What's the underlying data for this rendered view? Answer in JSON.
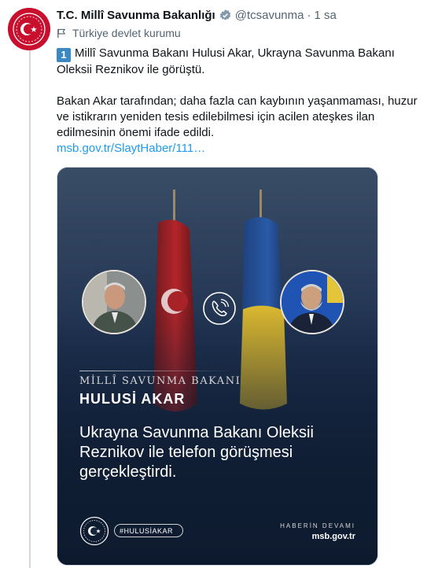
{
  "tweet": {
    "author_name": "T.C. Millî Savunma Bakanlığı",
    "verified_icon": "verified-badge-icon",
    "handle": "@tcsavunma",
    "separator": "·",
    "time": "1 sa",
    "affiliation_label": "Türkiye devlet kurumu",
    "number_emoji": "1",
    "text_line1": "Millî Savunma Bakanı Hulusi Akar, Ukrayna Savunma Bakanı Oleksii Reznikov ile görüştü.",
    "text_para2": "Bakan Akar tarafından; daha fazla can kaybının yaşanmaması, huzur ve istikrarın yeniden tesis edilebilmesi için acilen ateşkes ilan edilmesinin önemi ifade edildi.",
    "link_text": "msb.gov.tr/SlaytHaber/111…"
  },
  "media_card": {
    "subtitle": "MİLLÎ SAVUNMA BAKANI",
    "name": "HULUSİ AKAR",
    "headline_lines": [
      "Ukrayna Savunma Bakanı Oleksii",
      "Reznikov ile telefon görüşmesi",
      "gerçekleştirdi."
    ],
    "hashtag": "#HULUSİAKAR",
    "more_label": "HABERİN DEVAMI",
    "more_site": "msb.gov.tr"
  },
  "colors": {
    "link": "#1d9bf0",
    "muted": "#536471",
    "brand_red": "#c8102e",
    "card_bg": "#15263f"
  }
}
